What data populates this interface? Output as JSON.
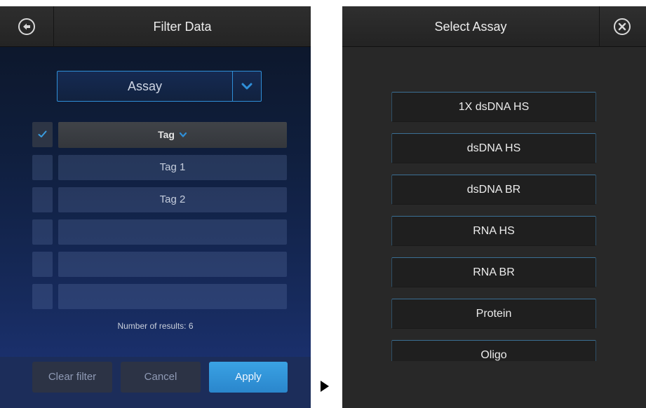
{
  "filter_panel": {
    "title": "Filter Data",
    "dropdown": {
      "value": "Assay"
    },
    "tag_header": "Tag",
    "tags": [
      "Tag 1",
      "Tag 2",
      "",
      "",
      ""
    ],
    "results_text": "Number of results: 6",
    "buttons": {
      "clear": "Clear filter",
      "cancel": "Cancel",
      "apply": "Apply"
    }
  },
  "select_panel": {
    "title": "Select Assay",
    "assays": [
      "1X dsDNA HS",
      "dsDNA HS",
      "dsDNA BR",
      "RNA HS",
      "RNA BR",
      "Protein",
      "Oligo"
    ]
  },
  "icons": {
    "back": "back-arrow-icon",
    "close": "close-x-icon",
    "transition": "play-arrow-icon"
  },
  "colors": {
    "accent": "#2f8fd8",
    "apply": "#3399dd"
  }
}
